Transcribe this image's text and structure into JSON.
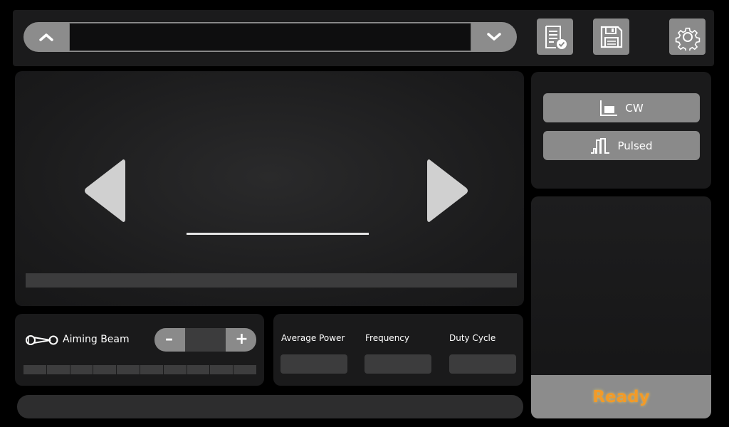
{
  "preset": {
    "name": "",
    "up_icon": "chevron-up-icon",
    "down_icon": "chevron-down-icon"
  },
  "toolbar": {
    "report_icon": "document-check-icon",
    "save_icon": "floppy-save-icon",
    "settings_icon": "gear-icon"
  },
  "display": {
    "value": "",
    "progress": 0
  },
  "modes": [
    {
      "label": "CW",
      "icon": "cw-waveform-icon"
    },
    {
      "label": "Pulsed",
      "icon": "pulse-waveform-icon"
    }
  ],
  "status": {
    "text": "Ready",
    "color": "#f39a28"
  },
  "aiming": {
    "label": "Aiming Beam",
    "icon": "aiming-beam-icon",
    "minus_label": "–",
    "plus_label": "+",
    "value": "",
    "level_segments": 10,
    "level": 0
  },
  "params": {
    "average_power": {
      "label": "Average Power",
      "value": ""
    },
    "frequency": {
      "label": "Frequency",
      "value": ""
    },
    "duty_cycle": {
      "label": "Duty Cycle",
      "value": ""
    }
  },
  "message": {
    "text": ""
  }
}
